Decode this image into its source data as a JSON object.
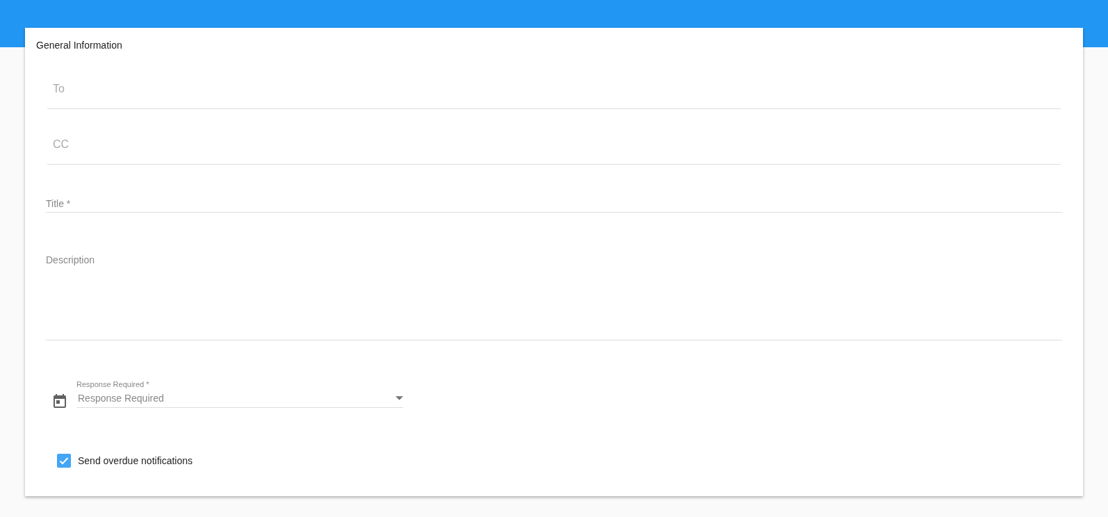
{
  "card": {
    "title": "General Information"
  },
  "fields": [
    {
      "kind": "input",
      "placeholder": "To"
    },
    {
      "kind": "input",
      "placeholder": "CC"
    },
    {
      "kind": "labeled",
      "label": "Title *"
    },
    {
      "kind": "textarea",
      "label": "Description"
    }
  ],
  "select": {
    "label": "Response Required *",
    "placeholder": "Response Required"
  },
  "checkbox": {
    "label": "Send overdue notifications",
    "checked": true
  }
}
